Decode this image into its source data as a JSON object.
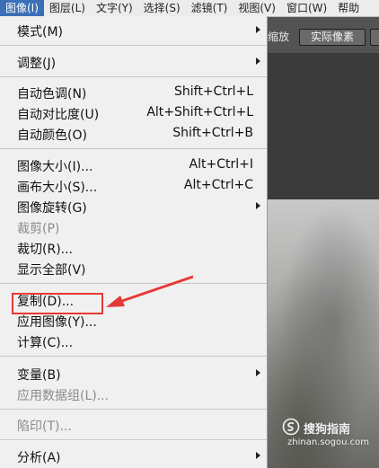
{
  "menubar": [
    "图像(I)",
    "图层(L)",
    "文字(Y)",
    "选择(S)",
    "滤镜(T)",
    "视图(V)",
    "窗口(W)",
    "帮助"
  ],
  "options_bar": {
    "partial_text": "缩放",
    "actual_pixels_button": "实际像素"
  },
  "watermark": {
    "brand": "搜狗指南",
    "url": "zhinan.sogou.com"
  },
  "menu": {
    "mode": "模式(M)",
    "adjust": "调整(J)",
    "auto_tone": "自动色调(N)",
    "auto_tone_shortcut": "Shift+Ctrl+L",
    "auto_contrast": "自动对比度(U)",
    "auto_contrast_shortcut": "Alt+Shift+Ctrl+L",
    "auto_color": "自动颜色(O)",
    "auto_color_shortcut": "Shift+Ctrl+B",
    "image_size": "图像大小(I)...",
    "image_size_shortcut": "Alt+Ctrl+I",
    "canvas_size": "画布大小(S)...",
    "canvas_size_shortcut": "Alt+Ctrl+C",
    "image_rotation": "图像旋转(G)",
    "crop": "裁剪(P)",
    "trim": "裁切(R)...",
    "reveal_all": "显示全部(V)",
    "duplicate": "复制(D)...",
    "apply_image": "应用图像(Y)...",
    "calculations": "计算(C)...",
    "variables": "变量(B)",
    "apply_data_set": "应用数据组(L)...",
    "trap": "陷印(T)...",
    "analysis": "分析(A)"
  }
}
